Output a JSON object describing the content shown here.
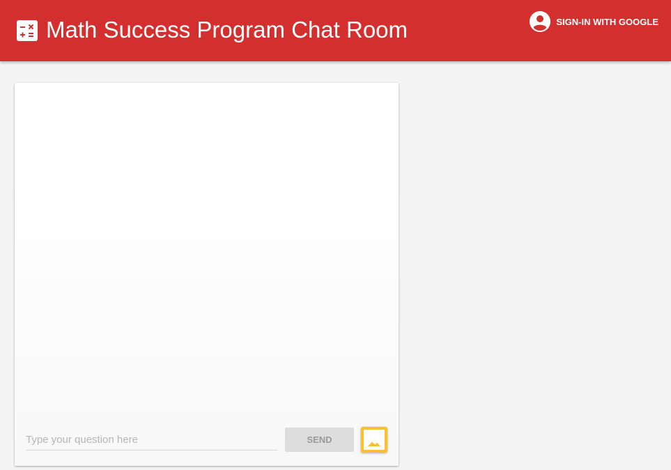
{
  "header": {
    "title": "Math Success Program Chat Room",
    "app_icon": "calculator-icon",
    "signin_label": "SIGN-IN WITH GOOGLE",
    "signin_icon": "account-circle-icon",
    "background_color": "#d32f2f"
  },
  "chat": {
    "input_placeholder": "Type your question here",
    "input_value": "",
    "send_label": "SEND",
    "image_button_icon": "image-icon",
    "image_button_color": "#fbc02d"
  }
}
